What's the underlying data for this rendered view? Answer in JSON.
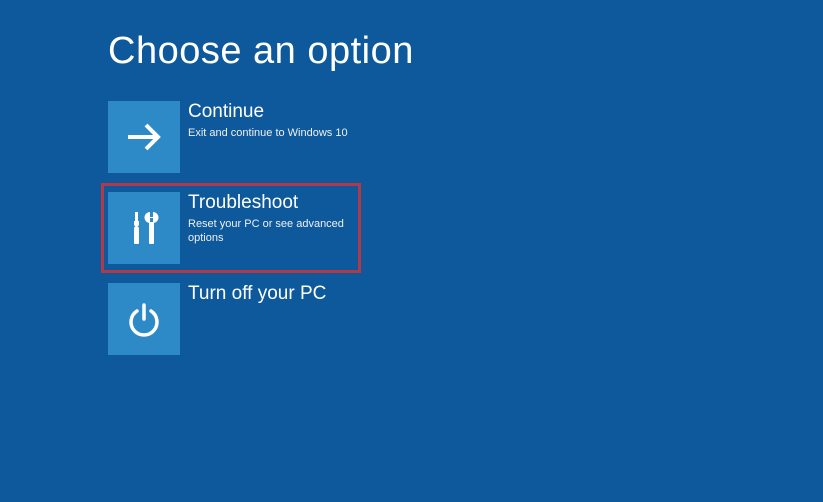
{
  "page": {
    "title": "Choose an option"
  },
  "options": {
    "continue": {
      "title": "Continue",
      "subtitle": "Exit and continue to Windows 10"
    },
    "troubleshoot": {
      "title": "Troubleshoot",
      "subtitle": "Reset your PC or see advanced options"
    },
    "turnoff": {
      "title": "Turn off your PC",
      "subtitle": ""
    }
  },
  "colors": {
    "background": "#0e599c",
    "tile": "#2e8ac7",
    "highlight_border": "#b23a48"
  }
}
